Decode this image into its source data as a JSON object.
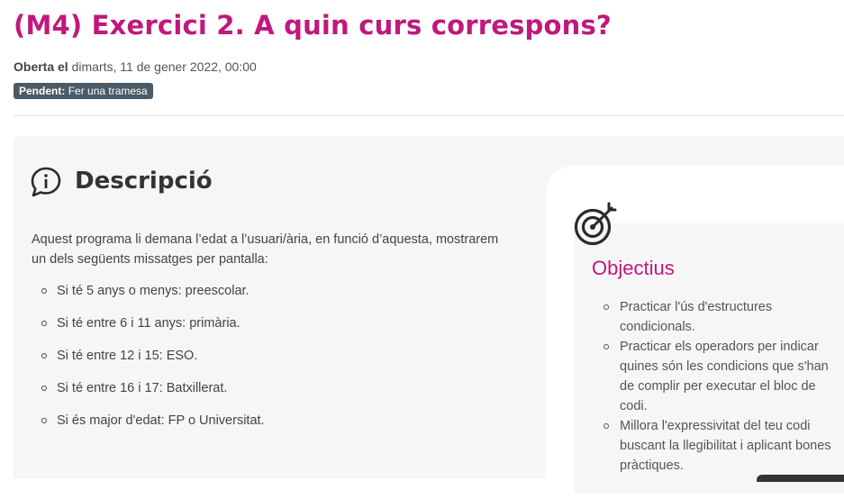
{
  "page": {
    "title": "(M4) Exercici 2. A quin curs correspons?",
    "opened_label": "Oberta el",
    "opened_date": "dimarts, 11 de gener 2022, 00:00",
    "badge_label": "Pendent:",
    "badge_text": "Fer una tramesa"
  },
  "description": {
    "heading": "Descripció",
    "intro": "Aquest programa li demana l’edat a l’usuari/ària, en funció d’aquesta, mostrarem un dels següents missatges per pantalla:",
    "items": [
      "Si té 5 anys o menys: preescolar.",
      "Si té entre 6 i 11 anys: primària.",
      "Si té entre 12 i 15: ESO.",
      "Si té entre 16 i 17: Batxillerat.",
      "Si és major d'edat: FP o Universitat."
    ]
  },
  "objectives": {
    "heading": "Objectius",
    "items": [
      "Practicar l'ús d'estructures condicionals.",
      "Practicar els operadors per indicar quines són les condicions que s'han de complir per executar el bloc de codi.",
      "Millora l'expressivitat del teu codi buscant la llegibilitat i aplicant bones pràctiques."
    ]
  },
  "icons": {
    "description": "info-speech-bubble-icon",
    "objectives": "target-dart-icon"
  },
  "colors": {
    "accent": "#c0187c",
    "badge_bg": "#4a5a66",
    "panel_bg": "#f6f6f6"
  }
}
